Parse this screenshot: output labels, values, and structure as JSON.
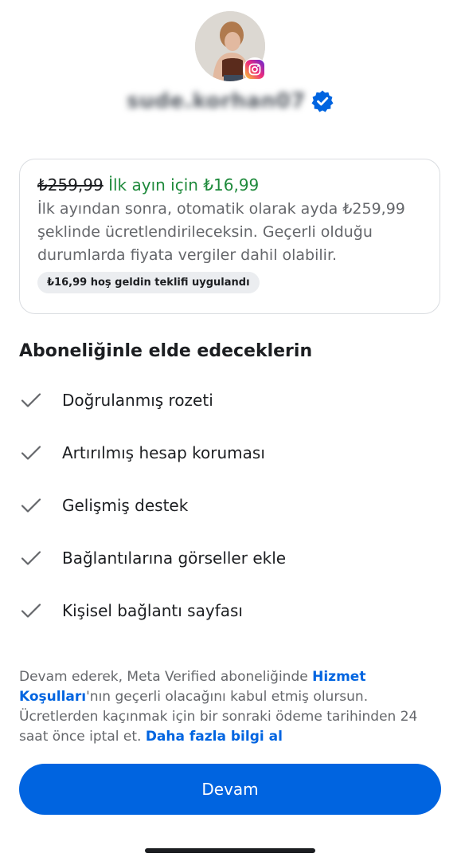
{
  "profile": {
    "username": "sude.korhan07",
    "avatar_icon": "profile-photo",
    "badge_icon": "instagram-icon",
    "verified_icon": "verified-badge-icon"
  },
  "price_card": {
    "old_price": "₺259,99",
    "offer": "İlk ayın için ₺16,99",
    "description": "İlk ayından sonra, otomatik olarak ayda ₺259,99 şeklinde ücretlendirileceksin. Geçerli olduğu durumlarda fiyata vergiler dahil olabilir.",
    "welcome_pill": "₺16,99 hoş geldin teklifi uygulandı"
  },
  "benefits": {
    "title": "Aboneliğinle elde edeceklerin",
    "items": [
      {
        "label": "Doğrulanmış rozeti",
        "icon": "check-icon"
      },
      {
        "label": "Artırılmış hesap koruması",
        "icon": "check-icon"
      },
      {
        "label": "Gelişmiş destek",
        "icon": "check-icon"
      },
      {
        "label": "Bağlantılarına görseller ekle",
        "icon": "check-icon"
      },
      {
        "label": "Kişisel bağlantı sayfası",
        "icon": "check-icon"
      }
    ]
  },
  "legal": {
    "part1": "Devam ederek, Meta Verified aboneliğinde ",
    "terms_link": "Hizmet Koşulları",
    "part2": "'nın geçerli olacağını kabul etmiş olursun. Ücretlerden kaçınmak için bir sonraki ödeme tarihinden 24 saat önce iptal et. ",
    "learn_more_link": "Daha fazla bilgi al"
  },
  "actions": {
    "continue_label": "Devam"
  },
  "colors": {
    "primary": "#0064e0",
    "offer_green": "#1f8a3c",
    "secondary_text": "#65676b",
    "card_border": "#dadde1"
  }
}
